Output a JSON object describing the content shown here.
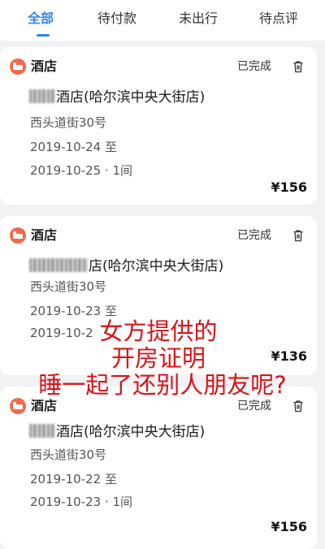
{
  "tabs": [
    {
      "label": "全部",
      "active": true
    },
    {
      "label": "待付款",
      "active": false
    },
    {
      "label": "未出行",
      "active": false
    },
    {
      "label": "待点评",
      "active": false
    }
  ],
  "accent_color": "#2e86ee",
  "orders": [
    {
      "type": "酒店",
      "status": "已完成",
      "hotel_name": "酒店(哈尔滨中央大街店)",
      "address": "西头道街30号",
      "checkin": "2019-10-24 至",
      "checkout": "2019-10-25 · 1间",
      "price": "¥156"
    },
    {
      "type": "酒店",
      "status": "已完成",
      "hotel_name": "店(哈尔滨中央大街店)",
      "address": "西头道街30号",
      "checkin": "2019-10-23 至",
      "checkout": "2019-10-2",
      "price": "¥136"
    },
    {
      "type": "酒店",
      "status": "已完成",
      "hotel_name": "酒店(哈尔滨中央大街店)",
      "address": "西头道街30号",
      "checkin": "2019-10-22 至",
      "checkout": "2019-10-23 · 1间",
      "price": "¥156"
    }
  ],
  "overlay_caption": {
    "line1": "女方提供的",
    "line2": "开房证明",
    "line3": "睡一起了还别人朋友呢?"
  }
}
